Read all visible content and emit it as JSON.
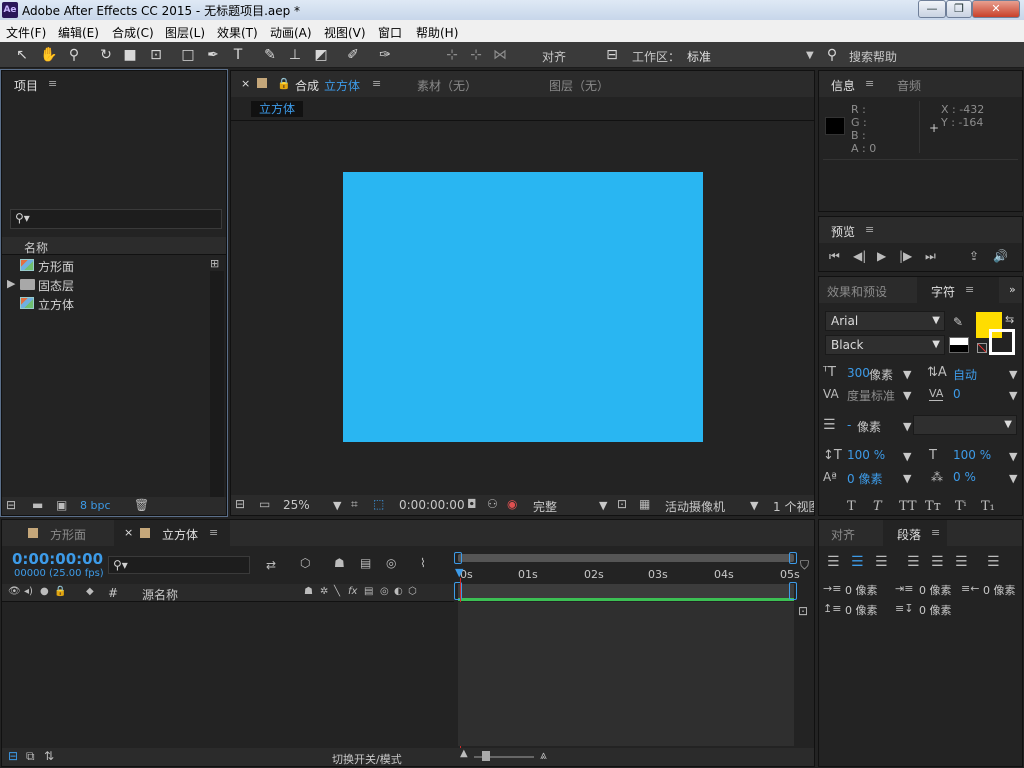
{
  "window": {
    "app_logo": "Ae",
    "title": "Adobe After Effects CC 2015 - 无标题项目.aep *"
  },
  "menu": [
    "文件(F)",
    "编辑(E)",
    "合成(C)",
    "图层(L)",
    "效果(T)",
    "动画(A)",
    "视图(V)",
    "窗口",
    "帮助(H)"
  ],
  "toolbar": {
    "align_label": "对齐",
    "workspace_label": "工作区：",
    "workspace_value": "标准",
    "search_label": "搜索帮助"
  },
  "project": {
    "title": "项目",
    "search_placeholder": "",
    "col_name": "名称",
    "items": [
      {
        "name": "方形面",
        "type": "comp"
      },
      {
        "name": "固态层",
        "type": "folder"
      },
      {
        "name": "立方体",
        "type": "comp"
      }
    ],
    "bpc": "8 bpc"
  },
  "comp_viewer": {
    "tab_prefix": "合成",
    "tab_name": "立方体",
    "footage_tab": "素材（无）",
    "layer_tab": "图层（无）",
    "breadcrumb": "立方体",
    "solid_color": "#29b6f2",
    "zoom": "25%",
    "timecode": "0:00:00:00",
    "resolution": "完整",
    "camera": "活动摄像机",
    "views": "1 个视图"
  },
  "info": {
    "title": "信息",
    "audio_tab": "音频",
    "r": "R :",
    "g": "G :",
    "b": "B :",
    "a": "A : 0",
    "x": "X : -432",
    "y": "Y : -164"
  },
  "preview": {
    "title": "预览"
  },
  "character": {
    "effects_tab": "效果和预设",
    "title": "字符",
    "font": "Arial",
    "style": "Black",
    "fill_color": "#ffdd00",
    "size_value": "300",
    "size_unit": "像素",
    "leading": "自动",
    "kerning": "度量标准",
    "tracking": "0",
    "stroke_value": "-",
    "stroke_unit": "像素",
    "vscale": "100 %",
    "hscale": "100 %",
    "baseline": "0 像素",
    "tsume": "0 %"
  },
  "paragraph": {
    "align_tab": "对齐",
    "title": "段落",
    "indent_left": "0 像素",
    "indent_first": "0 像素",
    "indent_right": "0 像素",
    "space_before": "0 像素",
    "space_after": "0 像素"
  },
  "timeline": {
    "tab1": "方形面",
    "tab2": "立方体",
    "timecode": "0:00:00:00",
    "frames": "00000 (25.00 fps)",
    "col_hash": "#",
    "col_source": "源名称",
    "ruler": [
      "0s",
      "01s",
      "02s",
      "03s",
      "04s",
      "05s"
    ],
    "footer_label": "切换开关/模式"
  }
}
